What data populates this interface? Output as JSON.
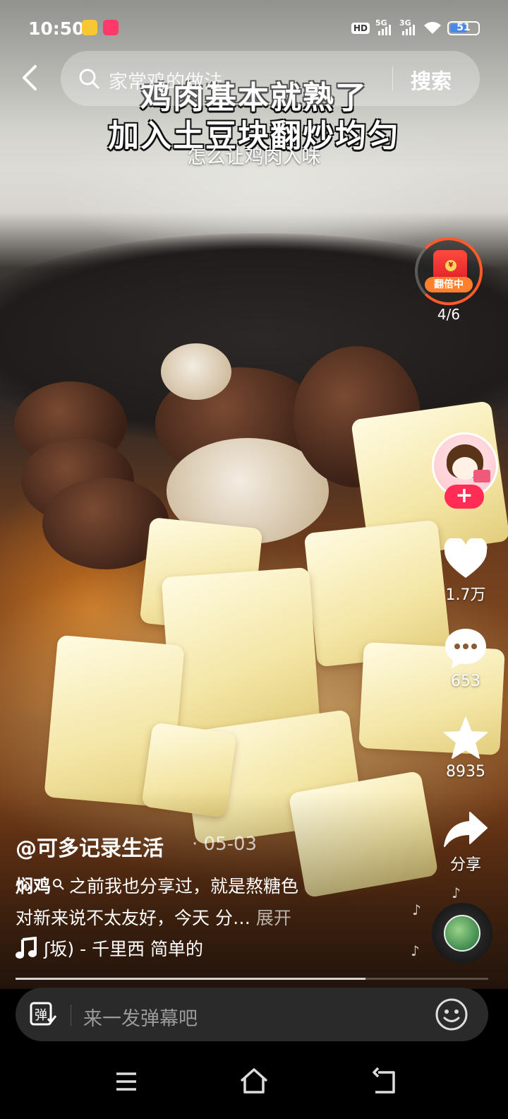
{
  "status_bar": {
    "time": "10:50",
    "hd": "HD",
    "network1": "5G",
    "network2": "3G",
    "battery": "51"
  },
  "search": {
    "query": "家常鸡的做法",
    "button": "搜索"
  },
  "captions": {
    "line1": "鸡肉基本就熟了",
    "line2": "加入土豆块翻炒均匀",
    "line3": "怎么让鸡肉入味"
  },
  "red_packet": {
    "label": "翻倍中",
    "progress": "4/6"
  },
  "actions": {
    "likes": "1.7万",
    "comments": "653",
    "favorites": "8935",
    "share": "分享"
  },
  "post": {
    "author": "@可多记录生活",
    "date": "· 05-03",
    "tag": "焖鸡",
    "desc_line1": "之前我也分享过，就是熬糖色",
    "desc_line2": "对新来说不太友好，今天 分…",
    "expand": "展开",
    "music": "ʃ坂) - 千里西     简单的"
  },
  "danmaku": {
    "placeholder": "来一发弹幕吧",
    "icon_label": "弹"
  },
  "colors": {
    "accent_red": "#ff2d55",
    "packet_orange": "#ff7f2a",
    "battery_blue": "#4a88e8"
  },
  "video_progress": 0.74
}
